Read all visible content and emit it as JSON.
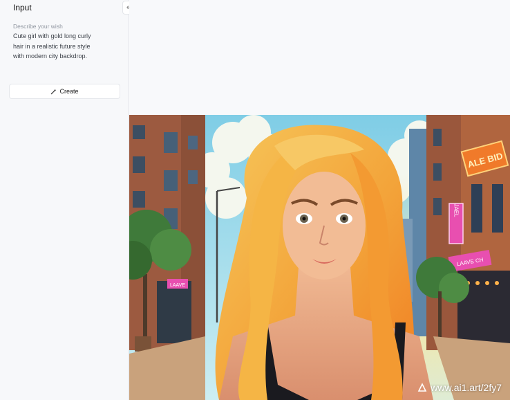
{
  "sidebar": {
    "title": "Input",
    "collapse_icon": "«",
    "prompt_label": "Describe your wish",
    "prompt_text": "Cute girl with gold long curly hair in a realistic future style with modern city backdrop.",
    "create_label": "Create",
    "create_icon": "magic-wand-icon"
  },
  "result": {
    "sign_top": "ALE BID",
    "sign_vertical": "JAEL",
    "sign_bar": "LAAVE CH",
    "sign_left": "LAAVE",
    "watermark": "www.ai1.art/2fy7"
  },
  "colors": {
    "sky": "#8fd3e8",
    "hair": "#f4a73a",
    "building_brick": "#a65a3e",
    "neon_pink": "#e84fb0",
    "neon_orange": "#f07a2a"
  }
}
